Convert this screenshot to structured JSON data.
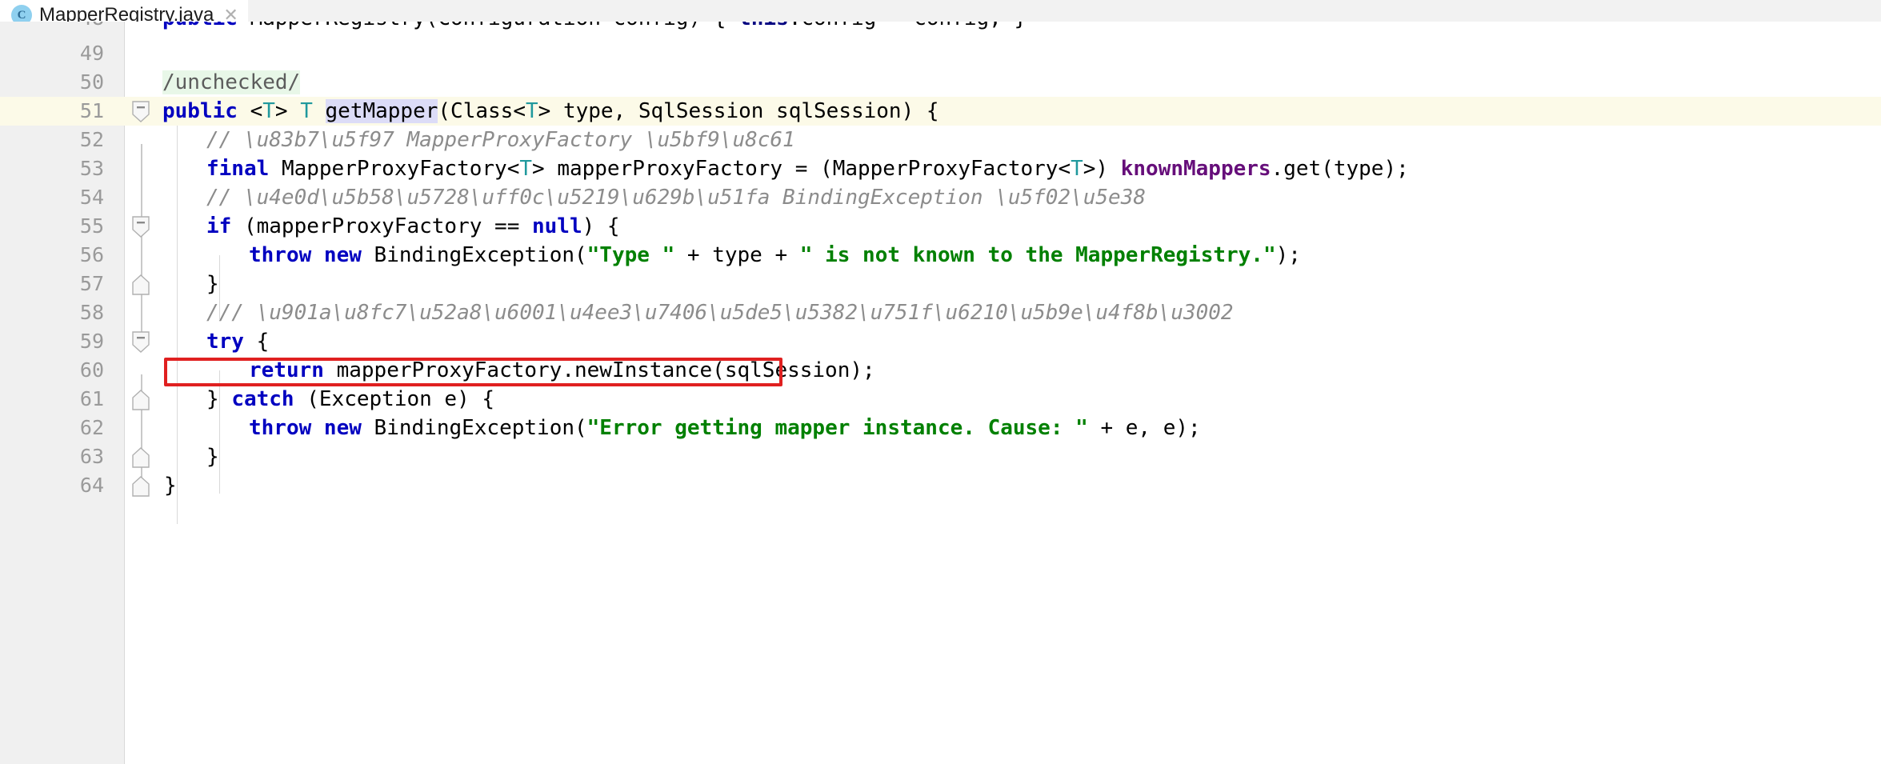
{
  "tab": {
    "icon": "java-class-icon",
    "icon_letter": "C",
    "title": "MapperRegistry.java",
    "close_label": "✕"
  },
  "editor": {
    "partial_top_line": "public MapperRegistry(Configuration config) { this.config = config; }",
    "lines": [
      {
        "no": "49",
        "text": ""
      },
      {
        "no": "50",
        "text": "    /unchecked/"
      },
      {
        "no": "51",
        "text": "    public <T> T getMapper(Class<T> type, SqlSession sqlSession) {"
      },
      {
        "no": "52",
        "text": "        // 获得 MapperProxyFactory 对象"
      },
      {
        "no": "53",
        "text": "        final MapperProxyFactory<T> mapperProxyFactory = (MapperProxyFactory<T>) knownMappers.get(type);"
      },
      {
        "no": "54",
        "text": "        // 不存在，则抛出 BindingException 异常"
      },
      {
        "no": "55",
        "text": "        if (mapperProxyFactory == null) {"
      },
      {
        "no": "56",
        "text": "            throw new BindingException(\"Type \" + type + \" is not known to the MapperRegistry.\");"
      },
      {
        "no": "57",
        "text": "        }"
      },
      {
        "no": "58",
        "text": "        /// 通过动态代理工厂生成实例。"
      },
      {
        "no": "59",
        "text": "        try {"
      },
      {
        "no": "60",
        "text": "            return mapperProxyFactory.newInstance(sqlSession);"
      },
      {
        "no": "61",
        "text": "        } catch (Exception e) {"
      },
      {
        "no": "62",
        "text": "            throw new BindingException(\"Error getting mapper instance. Cause: \" + e, e);"
      },
      {
        "no": "63",
        "text": "        }"
      },
      {
        "no": "64",
        "text": "    }"
      }
    ],
    "current_line_no": "51",
    "caret_line_no": "51",
    "selected_token": "getMapper",
    "annotated_line_no": "60",
    "annotation_color": "#e02020",
    "current_line_color": "#fcfae8",
    "selection_color": "#dcdcf7",
    "green_highlight_color": "#e8f7e8"
  },
  "gutter": {
    "fold_markers": [
      {
        "line": "51",
        "type": "fold-collapse-icon"
      },
      {
        "line": "55",
        "type": "fold-collapse-icon"
      },
      {
        "line": "57",
        "type": "fold-end-icon"
      },
      {
        "line": "59",
        "type": "fold-collapse-icon"
      },
      {
        "line": "61",
        "type": "fold-end-icon"
      },
      {
        "line": "63",
        "type": "fold-end-icon"
      },
      {
        "line": "64",
        "type": "fold-end-icon"
      }
    ]
  }
}
